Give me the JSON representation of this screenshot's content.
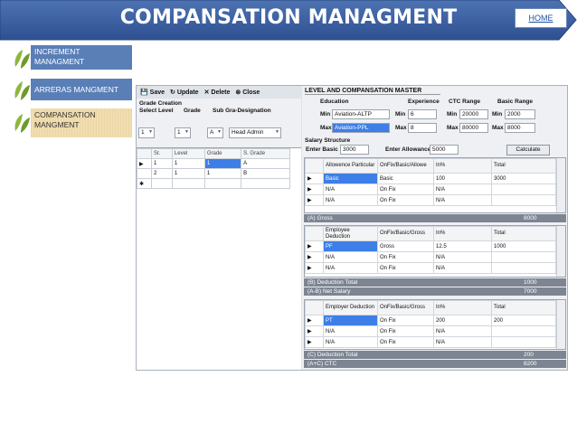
{
  "header": {
    "title": "COMPANSATION MANAGMENT",
    "home_label": "HOME"
  },
  "nav": {
    "items": [
      {
        "label": "INCREMENT MANAGMENT"
      },
      {
        "label": "ARRERAS MANGMENT"
      },
      {
        "label": "COMPANSATION MANGMENT"
      }
    ]
  },
  "toolbar": {
    "save": "Save",
    "update": "Update",
    "delete": "Delete",
    "close": "Close"
  },
  "grade_creation": {
    "title": "Grade Creation",
    "select_level": "Select Level",
    "grade": "Grade",
    "sub_grade_designation": "Sub Gra-Designation",
    "level_value": "1",
    "grade_value": "1",
    "sub_grade_value": "A",
    "designation_value": "Head Admin",
    "columns": [
      "Sr.",
      "Level",
      "Grade",
      "S. Grade"
    ],
    "rows": [
      {
        "marker": "▶",
        "sr": "1",
        "level": "1",
        "grade": "1",
        "sgrade": "A"
      },
      {
        "marker": "",
        "sr": "2",
        "level": "1",
        "grade": "1",
        "sgrade": "B"
      },
      {
        "marker": "✱",
        "sr": "",
        "level": "",
        "grade": "",
        "sgrade": ""
      }
    ]
  },
  "master": {
    "title": "LEVEL AND COMPANSATION MASTER",
    "education": "Education",
    "experience": "Experience",
    "ctc_range": "CTC Range",
    "basic_range": "Basic Range",
    "min": "Min",
    "max": "Max",
    "edu_min": "Aviation-ALTP",
    "edu_max": "Aviation-PPL",
    "exp_min": "6",
    "exp_max": "8",
    "ctc_min": "20000",
    "ctc_max": "80000",
    "basic_min": "2000",
    "basic_max": "8000",
    "salary_structure": "Salary Structure",
    "enter_basic": "Enter Basic",
    "basic_value": "3000",
    "enter_allowance": "Enter Allowance",
    "allowance_value": "5000",
    "calculate": "Calculate"
  },
  "allowance_table": {
    "h1": "Allowence Particular",
    "h2": "OnFix/Basic/Allowe",
    "h3": "In%",
    "h4": "Total",
    "rows": [
      {
        "name": "Basic",
        "type": "Basic",
        "pct": "100",
        "total": "3000"
      },
      {
        "name": "N/A",
        "type": "On Fix",
        "pct": "N/A",
        "total": ""
      },
      {
        "name": "N/A",
        "type": "On Fix",
        "pct": "N/A",
        "total": ""
      }
    ]
  },
  "gross": {
    "label": "(A) Gross",
    "value": "8000"
  },
  "employee_table": {
    "h1": "Employee Deduction",
    "h2": "OnFix/Basic/Gross",
    "h3": "In%",
    "h4": "Total",
    "rows": [
      {
        "name": "PF",
        "type": "Gross",
        "pct": "12.5",
        "total": "1000"
      },
      {
        "name": "N/A",
        "type": "On Fix",
        "pct": "N/A",
        "total": ""
      },
      {
        "name": "N/A",
        "type": "On Fix",
        "pct": "N/A",
        "total": ""
      }
    ]
  },
  "deduction_total": {
    "label": "(B) Deduction Total",
    "value": "1000"
  },
  "net_salary": {
    "label": "(A-B) Net Salary",
    "value": "7000"
  },
  "employer_table": {
    "h1": "Employer Deduction",
    "h2": "OnFix/Basic/Gross",
    "h3": "In%",
    "h4": "Total",
    "rows": [
      {
        "name": "PT",
        "type": "On Fix",
        "pct": "200",
        "total": "200"
      },
      {
        "name": "N/A",
        "type": "On Fix",
        "pct": "N/A",
        "total": ""
      },
      {
        "name": "N/A",
        "type": "On Fix",
        "pct": "N/A",
        "total": ""
      }
    ]
  },
  "c_deduction_total": {
    "label": "(C) Deduction Total",
    "value": "200"
  },
  "ctc": {
    "label": "(A+C) CTC",
    "value": "8200"
  },
  "colors": {
    "banner": "#3b5f9c",
    "nav": "#5a7fb7",
    "leaf": "#8db83d",
    "selection": "#3d7fe6"
  }
}
